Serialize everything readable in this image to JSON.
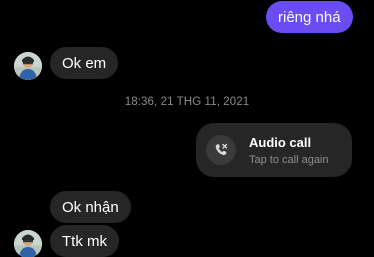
{
  "messages": [
    {
      "text": "riêng nhá",
      "direction": "outgoing"
    },
    {
      "text": "Ok em",
      "direction": "incoming"
    },
    {
      "text": "Ok nhận",
      "direction": "incoming"
    },
    {
      "text": "Ttk mk",
      "direction": "incoming"
    }
  ],
  "timestamp": "18:36, 21 THG 11, 2021",
  "call": {
    "title": "Audio call",
    "subtitle": "Tap to call again",
    "icon": "missed-call-icon"
  },
  "colors": {
    "background": "#000000",
    "outgoing_bubble": "#6a4cf3",
    "incoming_bubble": "#262626",
    "timestamp_text": "#8a8a8f"
  }
}
